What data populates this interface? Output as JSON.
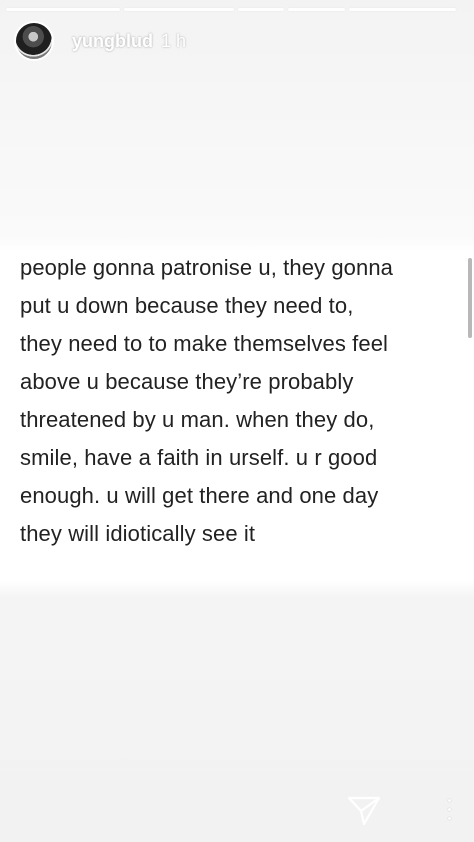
{
  "story": {
    "progress_segments": 5,
    "username": "yungblud",
    "time": "1 h",
    "caption_lines": [
      "people gonna patronise u, they gonna",
      "put u down because they need to,",
      "they need to to make themselves feel",
      "above u because they’re probably",
      "threatened by u man. when they do,",
      "smile, have a faith in urself. u r good",
      "enough. u will get there and one day",
      "they will idiotically see it"
    ]
  },
  "icons": {
    "send": "paper-plane-icon",
    "more": "more-vertical-icon"
  },
  "colors": {
    "text": "#222222",
    "overlay_text": "#ffffff",
    "background": "#f6f6f6"
  }
}
